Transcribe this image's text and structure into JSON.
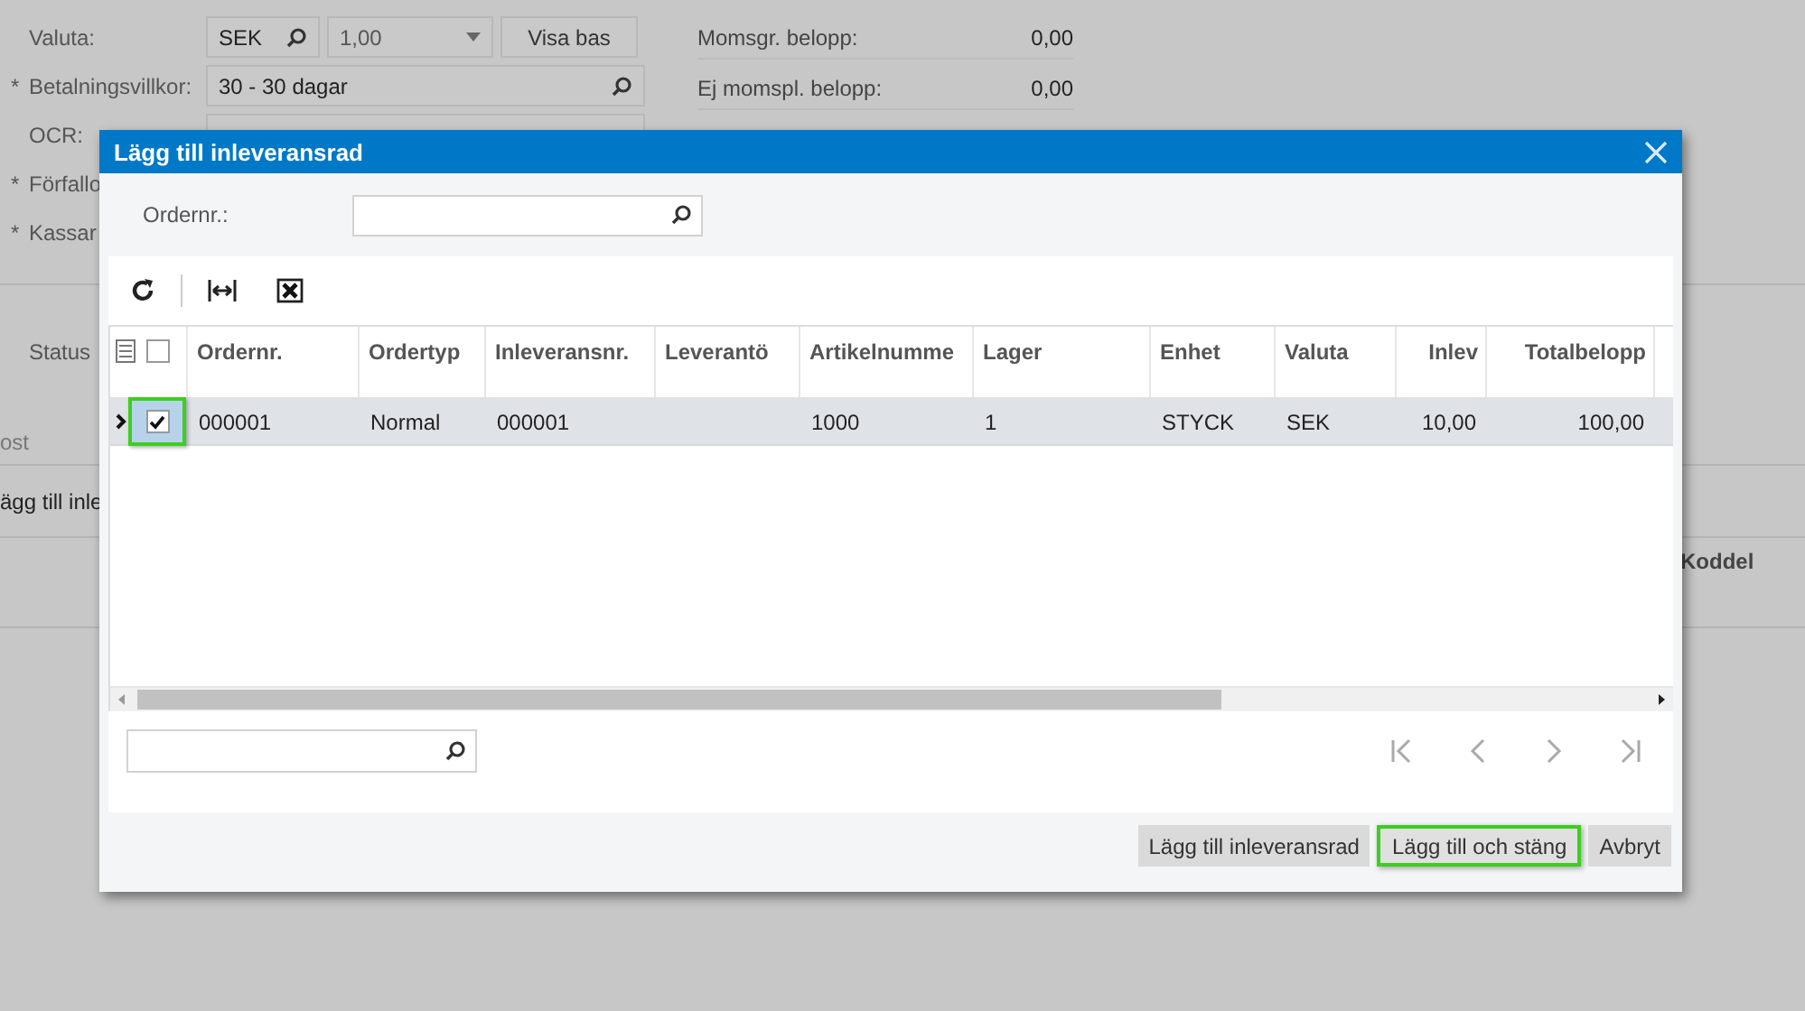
{
  "form": {
    "left": [
      {
        "kind": "currency",
        "label": "Valuta:",
        "code": "SEK",
        "rate": "1,00",
        "button": "Visa bas"
      },
      {
        "kind": "lookup",
        "label": "Betalningsvillkor:",
        "required_mark": "*",
        "value": "30 - 30 dagar"
      },
      {
        "kind": "text",
        "label": "OCR:"
      },
      {
        "label": "Förfallo",
        "required_mark": "*"
      },
      {
        "label": "Kassar",
        "required_mark": "*"
      }
    ],
    "right": [
      {
        "label": "Momsgr. belopp:",
        "value": "0,00"
      },
      {
        "label": "Ej momspl. belopp:",
        "value": "0,00"
      }
    ],
    "status_label": "Status",
    "tab": "ost",
    "section": "ägg till inle",
    "column": "Koddel"
  },
  "dialog": {
    "title": "Lägg till inleveransrad",
    "search_label": "Ordernr.:",
    "table": {
      "columns": [
        "Ordernr.",
        "Ordertyp",
        "Inleveransnr.",
        "Leverantö",
        "Artikelnumme",
        "Lager",
        "Enhet",
        "Valuta",
        "Inlev",
        "Totalbelopp"
      ],
      "all_checked": false,
      "rows": [
        {
          "selected": true,
          "checked": true,
          "highlighted": true,
          "cells": [
            "000001",
            "Normal",
            "000001",
            "",
            "1000",
            "1",
            "STYCK",
            "SEK",
            "10,00",
            "100,00"
          ]
        }
      ]
    },
    "buttons": [
      {
        "label": "Lägg till inleveransrad",
        "highlighted": false
      },
      {
        "label": "Lägg till och stäng",
        "highlighted": true
      },
      {
        "label": "Avbryt",
        "highlighted": false
      }
    ]
  }
}
